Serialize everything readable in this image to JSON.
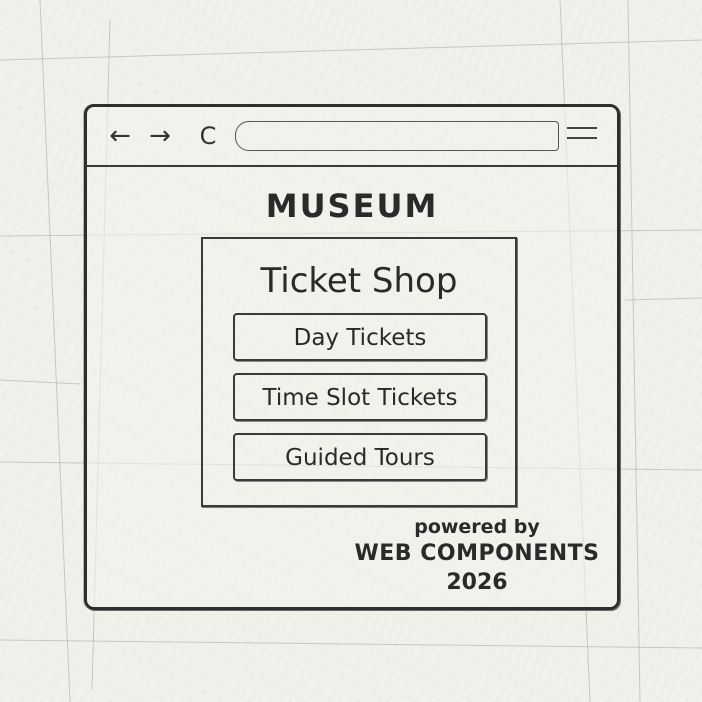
{
  "browser": {
    "back_icon": "←",
    "forward_icon": "→",
    "reload_icon": "C",
    "address_value": ""
  },
  "site": {
    "title": "MUSEUM"
  },
  "shop": {
    "title": "Ticket Shop",
    "options": [
      {
        "label": "Day Tickets"
      },
      {
        "label": "Time Slot Tickets"
      },
      {
        "label": "Guided Tours"
      }
    ]
  },
  "footer": {
    "powered_by": "powered by",
    "brand": "WEB COMPONENTS",
    "year": "2026"
  }
}
